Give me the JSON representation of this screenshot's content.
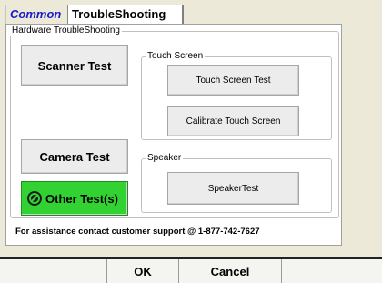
{
  "tabs": [
    {
      "label": "Common",
      "selected": false
    },
    {
      "label": "TroubleShooting",
      "selected": true
    }
  ],
  "hardware_group": {
    "legend": "Hardware TroubleShooting"
  },
  "buttons": {
    "scanner": "Scanner Test",
    "camera": "Camera Test",
    "other": "Other Test(s)"
  },
  "touch_group": {
    "legend": "Touch Screen",
    "test_label": "Touch Screen Test",
    "calibrate_label": "Calibrate Touch Screen"
  },
  "speaker_group": {
    "legend": "Speaker",
    "test_label": "SpeakerTest"
  },
  "support_text": "For assistance contact customer support @ 1-877-742-7627",
  "footer": {
    "ok_label": "OK",
    "cancel_label": "Cancel"
  },
  "colors": {
    "other_button": "#33d233",
    "common_tab_text": "#1a1acc"
  },
  "icons": {
    "other_button_icon": "no-symbol-icon"
  }
}
